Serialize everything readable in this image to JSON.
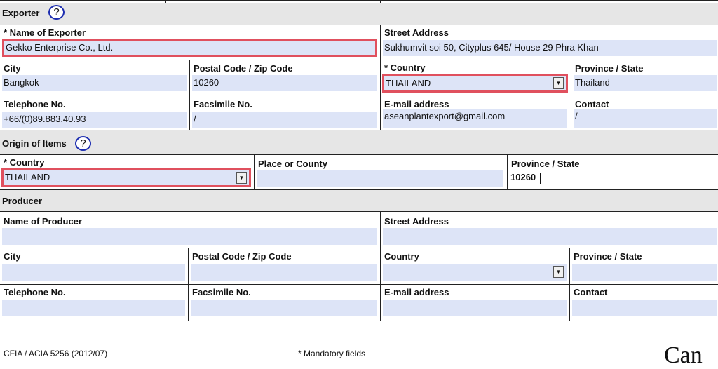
{
  "exporter": {
    "title": "Exporter",
    "help_glyph": "?",
    "name_label": "* Name of Exporter",
    "name_value": "Gekko Enterprise Co., Ltd.",
    "street_label": "Street Address",
    "street_value": "Sukhumvit soi 50, Cityplus 645/ House 29 Phra Khan",
    "city_label": "City",
    "city_value": "Bangkok",
    "postal_label": "Postal Code / Zip Code",
    "postal_value": "10260",
    "country_label": "* Country",
    "country_value": "THAILAND",
    "province_label": "Province / State",
    "province_value": "Thailand",
    "phone_label": "Telephone No.",
    "phone_value": "+66/(0)89.883.40.93",
    "fax_label": "Facsimile No.",
    "fax_value": "/",
    "email_label": "E-mail address",
    "email_value": "aseanplantexport@gmail.com",
    "contact_label": "Contact",
    "contact_value": "/"
  },
  "origin": {
    "title": "Origin of Items",
    "help_glyph": "?",
    "country_label": "* Country",
    "country_value": "THAILAND",
    "place_label": "Place or County",
    "place_value": "",
    "province_label": "Province / State",
    "province_value": "10260"
  },
  "producer": {
    "title": "Producer",
    "name_label": "Name of Producer",
    "street_label": "Street Address",
    "city_label": "City",
    "postal_label": "Postal Code / Zip Code",
    "country_label": "Country",
    "province_label": "Province / State",
    "phone_label": "Telephone No.",
    "fax_label": "Facsimile No.",
    "email_label": "E-mail address",
    "contact_label": "Contact"
  },
  "footer": {
    "form_code": "CFIA / ACIA 5256 (2012/07)",
    "mandatory_note": "* Mandatory fields",
    "brand": "Can"
  },
  "colors": {
    "field_fill": "#dde4f7",
    "error_border": "#e0505e",
    "section_fill": "#e6e6e6",
    "help_circle": "#1c2db0"
  },
  "icons": {
    "dropdown": "triangle-down",
    "help": "question-circle"
  }
}
